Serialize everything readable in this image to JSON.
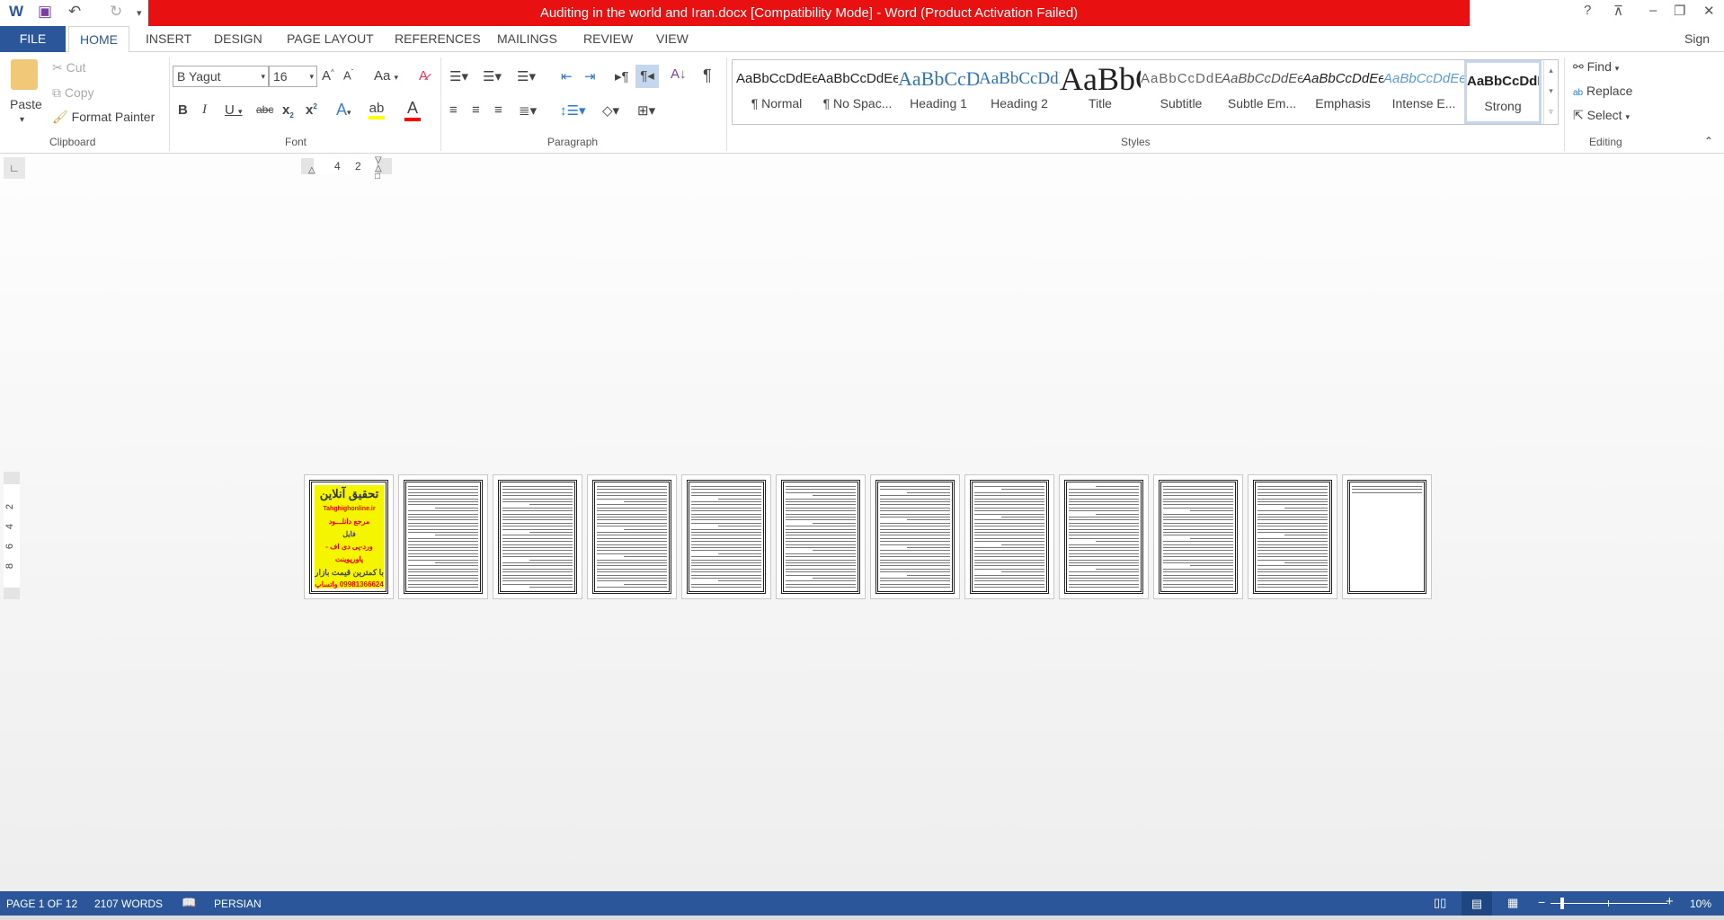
{
  "window": {
    "title": "Auditing in the world and Iran.docx [Compatibility Mode] -  Word (Product Activation Failed)",
    "help": "?",
    "sign_in": "Sign in"
  },
  "quick_access": {
    "icons": [
      "word-icon",
      "save-icon",
      "undo-icon",
      "redo-icon",
      "customize-icon"
    ]
  },
  "tabs": [
    {
      "label": "FILE"
    },
    {
      "label": "HOME",
      "active": true
    },
    {
      "label": "INSERT"
    },
    {
      "label": "DESIGN"
    },
    {
      "label": "PAGE LAYOUT"
    },
    {
      "label": "REFERENCES"
    },
    {
      "label": "MAILINGS"
    },
    {
      "label": "REVIEW"
    },
    {
      "label": "VIEW"
    }
  ],
  "clipboard": {
    "label": "Clipboard",
    "paste": "Paste",
    "cut": "Cut",
    "copy": "Copy",
    "format_painter": "Format Painter"
  },
  "font": {
    "label": "Font",
    "name": "B Yagut",
    "size": "16",
    "change_case": "Aa",
    "highlight_color": "#ffff00",
    "font_color": "#ff0000"
  },
  "paragraph": {
    "label": "Paragraph"
  },
  "styles": {
    "label": "Styles",
    "items": [
      {
        "preview": "AaBbCcDdEe",
        "name": "¶ Normal"
      },
      {
        "preview": "AaBbCcDdEe",
        "name": "¶ No Spac..."
      },
      {
        "preview": "AaBbCcDdEe",
        "name": "Heading 1"
      },
      {
        "preview": "AaBbCcDdEe",
        "name": "Heading 2"
      },
      {
        "preview": "AaBbCcDdEe",
        "name": "Title"
      },
      {
        "preview": "AaBbCcDdEe",
        "name": "Subtitle"
      },
      {
        "preview": "AaBbCcDdEe",
        "name": "Subtle Em..."
      },
      {
        "preview": "AaBbCcDdEe",
        "name": "Emphasis"
      },
      {
        "preview": "AaBbCcDdEe",
        "name": "Intense E..."
      },
      {
        "preview": "AaBbCcDdEe",
        "name": "Strong",
        "selected": true
      }
    ]
  },
  "editing": {
    "label": "Editing",
    "find": "Find",
    "replace": "Replace",
    "select": "Select"
  },
  "ruler": {
    "h_numbers": [
      "4",
      "2"
    ],
    "v_numbers": [
      "2",
      "4",
      "6",
      "8"
    ]
  },
  "ad_page": {
    "title": "تحقیق آنلاین",
    "site": "Tahghighonline.ir",
    "l1": "مرجع دانلـــود",
    "l2": "فایل",
    "l3": "ورد-پی دی اف - پاورپوینت",
    "l4": "با کمترین قیمت بازار",
    "l5": "09981366624 واتساپ"
  },
  "page_count": 12,
  "status": {
    "page": "PAGE 1 OF 12",
    "words": "2107 WORDS",
    "language": "PERSIAN",
    "zoom": "10%",
    "zoom_percent": 10
  },
  "colors": {
    "accent": "#2b579a",
    "title_bar": "#e81010"
  }
}
